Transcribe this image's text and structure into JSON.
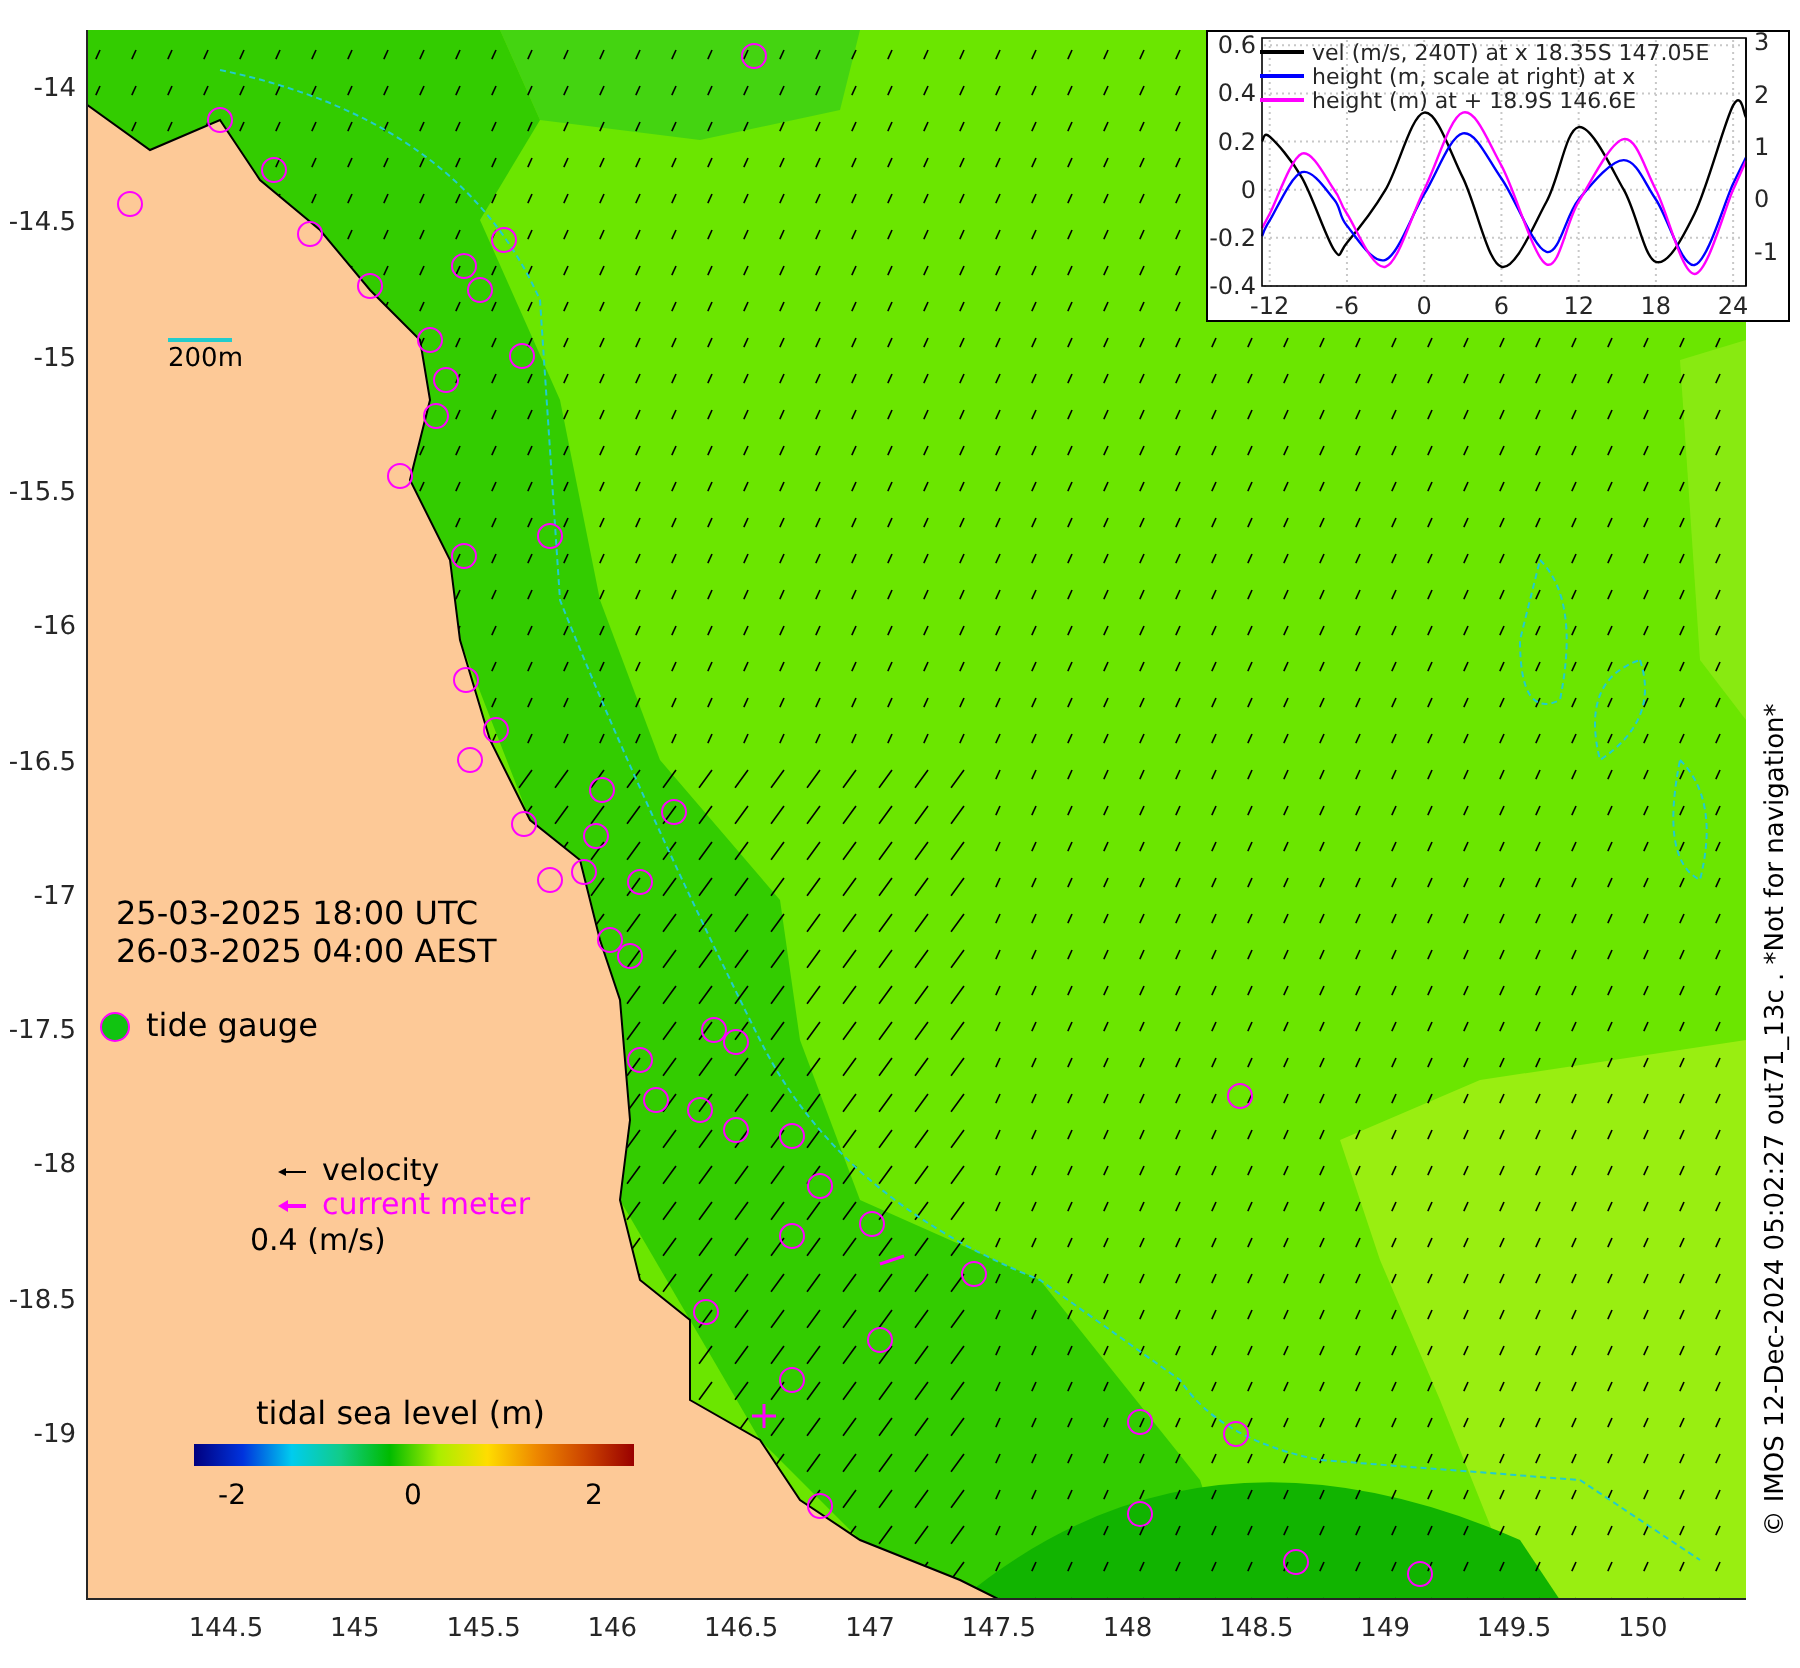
{
  "map": {
    "y_ticks": [
      "-14",
      "-14.5",
      "-15",
      "-15.5",
      "-16",
      "-16.5",
      "-17",
      "-17.5",
      "-18",
      "-18.5",
      "-19"
    ],
    "x_ticks": [
      "144.5",
      "145",
      "145.5",
      "146",
      "146.5",
      "147",
      "147.5",
      "148",
      "148.5",
      "149",
      "149.5",
      "150"
    ],
    "scale_label": "200m",
    "timestamps": [
      "25-03-2025 18:00 UTC",
      "26-03-2025 04:00 AEST"
    ],
    "tide_gauge_label": "tide gauge",
    "velocity_legend": [
      {
        "kind": "velocity",
        "label": "velocity",
        "color": "#000000"
      },
      {
        "kind": "current_meter",
        "label": "current meter",
        "color": "#ff00ff"
      }
    ],
    "velocity_scale": "0.4 (m/s)",
    "colorbar": {
      "title": "tidal sea level (m)",
      "ticks": [
        "-2",
        "0",
        "2"
      ]
    },
    "credit": "© IMOS 12-Dec-2024 05:02:27 out71_13c . *Not for navigation*"
  },
  "inset": {
    "chart_data": {
      "type": "line",
      "x": [
        -12.6,
        -12,
        -9.5,
        -7,
        -6,
        -3,
        0,
        3,
        6,
        9.5,
        12,
        15.5,
        18,
        21,
        24,
        25
      ],
      "grid": true,
      "xlim": [
        -12.6,
        25
      ],
      "ylim": [
        -0.4,
        0.63
      ],
      "y2lim": [
        -1.65,
        3.08
      ],
      "y2ticks": [
        3,
        2,
        1,
        0,
        -1
      ],
      "xticks": [
        {
          "value": -12,
          "label": "-12"
        },
        {
          "value": -6,
          "label": "-6"
        },
        {
          "value": 0,
          "label": "0"
        },
        {
          "value": 6,
          "label": "6"
        },
        {
          "value": 12,
          "label": "12"
        },
        {
          "value": 18,
          "label": "18"
        },
        {
          "value": 24,
          "label": "24"
        }
      ],
      "yticks": [
        {
          "value": 0.6,
          "label": "0.6"
        },
        {
          "value": 0.4,
          "label": "0.4"
        },
        {
          "value": 0.2,
          "label": "0.2"
        },
        {
          "value": 0,
          "label": "0"
        },
        {
          "value": -0.2,
          "label": "-0.2"
        },
        {
          "value": -0.4,
          "label": "-0.4"
        }
      ],
      "series": [
        {
          "name": "vel (m/s, 240T) at x 18.35S 147.05E",
          "color": "#000000",
          "values": [
            0.2,
            0.22,
            0.05,
            -0.25,
            -0.22,
            0.0,
            0.32,
            0.05,
            -0.32,
            -0.05,
            0.26,
            0.0,
            -0.3,
            -0.1,
            0.35,
            0.3
          ]
        },
        {
          "name": "height (m, scale at right) at x",
          "color": "#0000ff",
          "axis": "y2",
          "values": [
            -0.7,
            -0.4,
            0.52,
            0.0,
            -0.5,
            -1.15,
            0.1,
            1.26,
            0.4,
            -1.0,
            0.0,
            0.75,
            0.0,
            -1.25,
            0.3,
            0.8
          ]
        },
        {
          "name": "height (m) at + 18.9S 146.6E",
          "color": "#ff00ff",
          "values": [
            -0.16,
            -0.1,
            0.15,
            0.0,
            -0.1,
            -0.32,
            0.0,
            0.32,
            0.1,
            -0.31,
            -0.05,
            0.21,
            0.0,
            -0.35,
            0.0,
            0.12
          ]
        }
      ]
    }
  }
}
